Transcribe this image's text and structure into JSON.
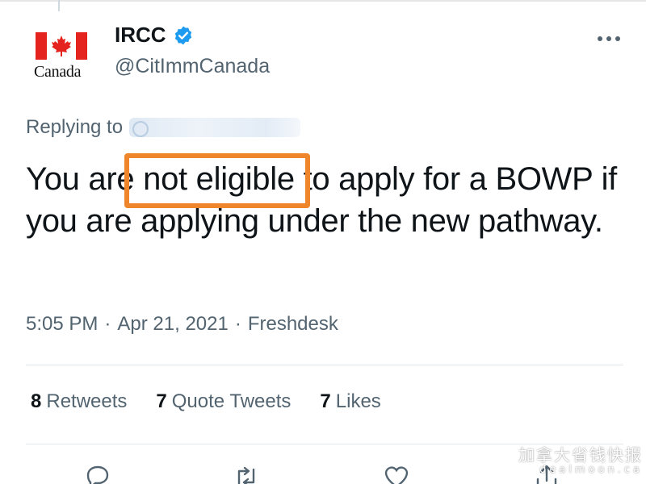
{
  "tweet": {
    "author": {
      "name": "IRCC",
      "handle": "@CitImmCanada",
      "logo_wordmark": "Canada",
      "verified": true
    },
    "replying_to_label": "Replying to",
    "text_parts": {
      "before": "You are ",
      "highlighted": "not eligible",
      "after": " to apply for a BOWP if you are applying under the new pathway."
    },
    "meta": {
      "time": "5:05 PM",
      "separator1": "·",
      "date": "Apr 21, 2021",
      "separator2": "·",
      "source": "Freshdesk"
    },
    "stats": {
      "retweets_count": "8",
      "retweets_label": "Retweets",
      "quotes_count": "7",
      "quotes_label": "Quote Tweets",
      "likes_count": "7",
      "likes_label": "Likes"
    }
  },
  "watermark": {
    "line1": "加拿大省钱快报",
    "line2": "dealmoon.ca"
  },
  "colors": {
    "highlight_box": "#f0862b",
    "verified_badge": "#1d9bf0",
    "flag_red": "#e4231e",
    "muted_text": "#536471"
  },
  "icons": [
    "maple-leaf-flag-icon",
    "verified-badge-icon",
    "more-options-icon",
    "reply-icon",
    "retweet-icon",
    "like-icon",
    "share-icon"
  ]
}
